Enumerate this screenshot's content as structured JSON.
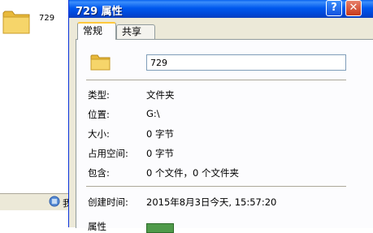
{
  "background": {
    "folder_label": "729",
    "taskbar_text": "我"
  },
  "dialog": {
    "title": "729 属性",
    "help_symbol": "?",
    "close_symbol": "✕",
    "tabs": [
      {
        "label": "常规",
        "active": true
      },
      {
        "label": "共享",
        "active": false
      }
    ],
    "name_value": "729",
    "properties": [
      {
        "label": "类型:",
        "value": "文件夹"
      },
      {
        "label": "位置:",
        "value": "G:\\"
      },
      {
        "label": "大小:",
        "value": "0 字节"
      },
      {
        "label": "占用空间:",
        "value": "0 字节"
      },
      {
        "label": "包含:",
        "value": "0 个文件，0 个文件夹"
      }
    ],
    "created": {
      "label": "创建时间:",
      "value": "2015年8月3日今天, 15:57:20"
    },
    "attributes_label": "属性"
  },
  "colors": {
    "title_bar": "#0058ee",
    "dialog_bg": "#ece9d8",
    "panel_bg": "#fcfcfe",
    "active_tab_accent": "#ffc83c"
  }
}
